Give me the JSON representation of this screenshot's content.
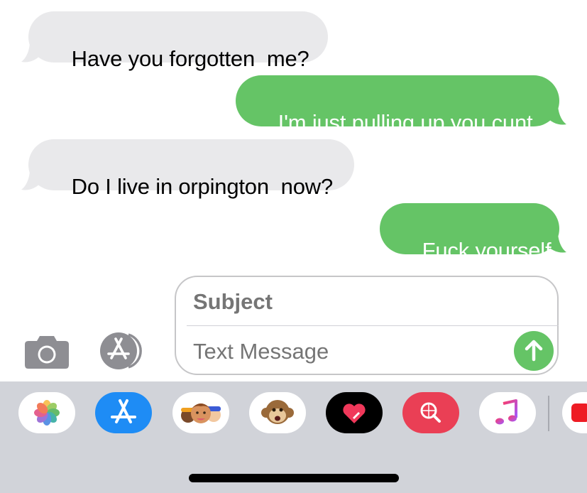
{
  "messages": [
    {
      "direction": "incoming",
      "text": "Have you forgotten  me?"
    },
    {
      "direction": "outgoing",
      "text": "I'm just pulling up you cunt"
    },
    {
      "direction": "incoming",
      "text": "Do I live in orpington  now?"
    },
    {
      "direction": "outgoing",
      "text": "Fuck yourself"
    }
  ],
  "composer": {
    "subject_placeholder": "Subject",
    "message_placeholder": "Text Message",
    "left_buttons": [
      "camera-icon",
      "app-store-icon"
    ],
    "send_icon": "arrow-up-icon"
  },
  "app_drawer": [
    "photos-app-icon",
    "app-store-app-icon",
    "memoji-stickers-icon",
    "animoji-monkey-icon",
    "digital-touch-icon",
    "images-search-icon",
    "music-app-icon",
    "partial-app-icon"
  ],
  "colors": {
    "incoming_bubble": "#e9e9eb",
    "outgoing_bubble": "#65c466",
    "send_button": "#65c466",
    "drawer_background": "#d1d3d9"
  }
}
